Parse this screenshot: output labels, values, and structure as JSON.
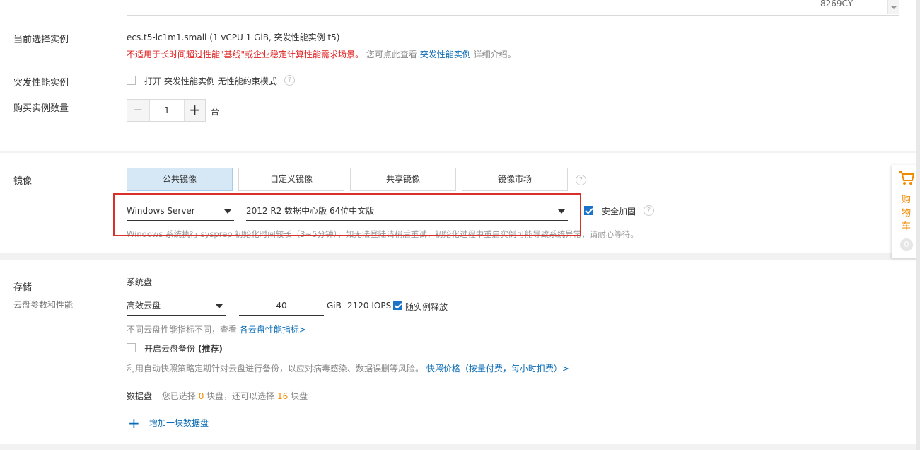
{
  "top_textarea": {
    "value": "8269CY"
  },
  "instance": {
    "label": "当前选择实例",
    "spec": "ecs.t5-lc1m1.small (1 vCPU 1 GiB, 突发性能实例 t5)",
    "warning": "不适用于长时间超过性能\"基线\"或企业稳定计算性能需求场景。",
    "hint_prefix": "您可点此查看",
    "hint_link": "突发性能实例",
    "hint_suffix": "详细介绍。"
  },
  "burst": {
    "label": "突发性能实例",
    "option_prefix": "打开",
    "option_link": "突发性能实例",
    "option_suffix": "无性能约束模式"
  },
  "quantity": {
    "label": "购买实例数量",
    "minus": "−",
    "value": "1",
    "plus": "+",
    "unit": "台"
  },
  "image": {
    "label": "镜像",
    "tabs": [
      {
        "label": "公共镜像",
        "active": true
      },
      {
        "label": "自定义镜像",
        "active": false
      },
      {
        "label": "共享镜像",
        "active": false
      },
      {
        "label": "镜像市场",
        "active": false
      }
    ],
    "os_select": "Windows Server",
    "version_select": "2012 R2 数据中心版 64位中文版",
    "security_label": "安全加固",
    "notice": "Windows 系统执行 sysprep 初始化时间较长（3~5分钟），如无法登陆请稍后重试，初始化过程中重启实例可能导致系统异常，请耐心等待。"
  },
  "storage": {
    "label": "存储",
    "sublabel": "云盘参数和性能",
    "system_disk_title": "系统盘",
    "disk_type": "高效云盘",
    "size": "40",
    "unit": "GiB",
    "iops": "2120 IOPS",
    "release_label": "随实例释放",
    "perf_hint_prefix": "不同云盘性能指标不同，查看",
    "perf_hint_link": "各云盘性能指标>",
    "backup_label": "开启云盘备份",
    "backup_recommend": "(推荐)",
    "backup_desc": "利用自动快照策略定期针对云盘进行备份，以应对病毒感染、数据误删等风险。",
    "backup_price_link": "快照价格（按量付费，每小时扣费）>",
    "data_disk_title": "数据盘",
    "data_disk_hint_1": "您已选择",
    "data_disk_selected": "0",
    "data_disk_hint_2": "块盘，还可以选择",
    "data_disk_remaining": "16",
    "data_disk_hint_3": "块盘",
    "add_data_disk": "增加一块数据盘"
  },
  "cart": {
    "label_1": "购",
    "label_2": "物",
    "label_3": "车",
    "count": "0"
  },
  "colors": {
    "accent": "#1a73c8",
    "warning": "#e02020",
    "cart": "#f08a00",
    "highlight_box": "#d9302c"
  }
}
